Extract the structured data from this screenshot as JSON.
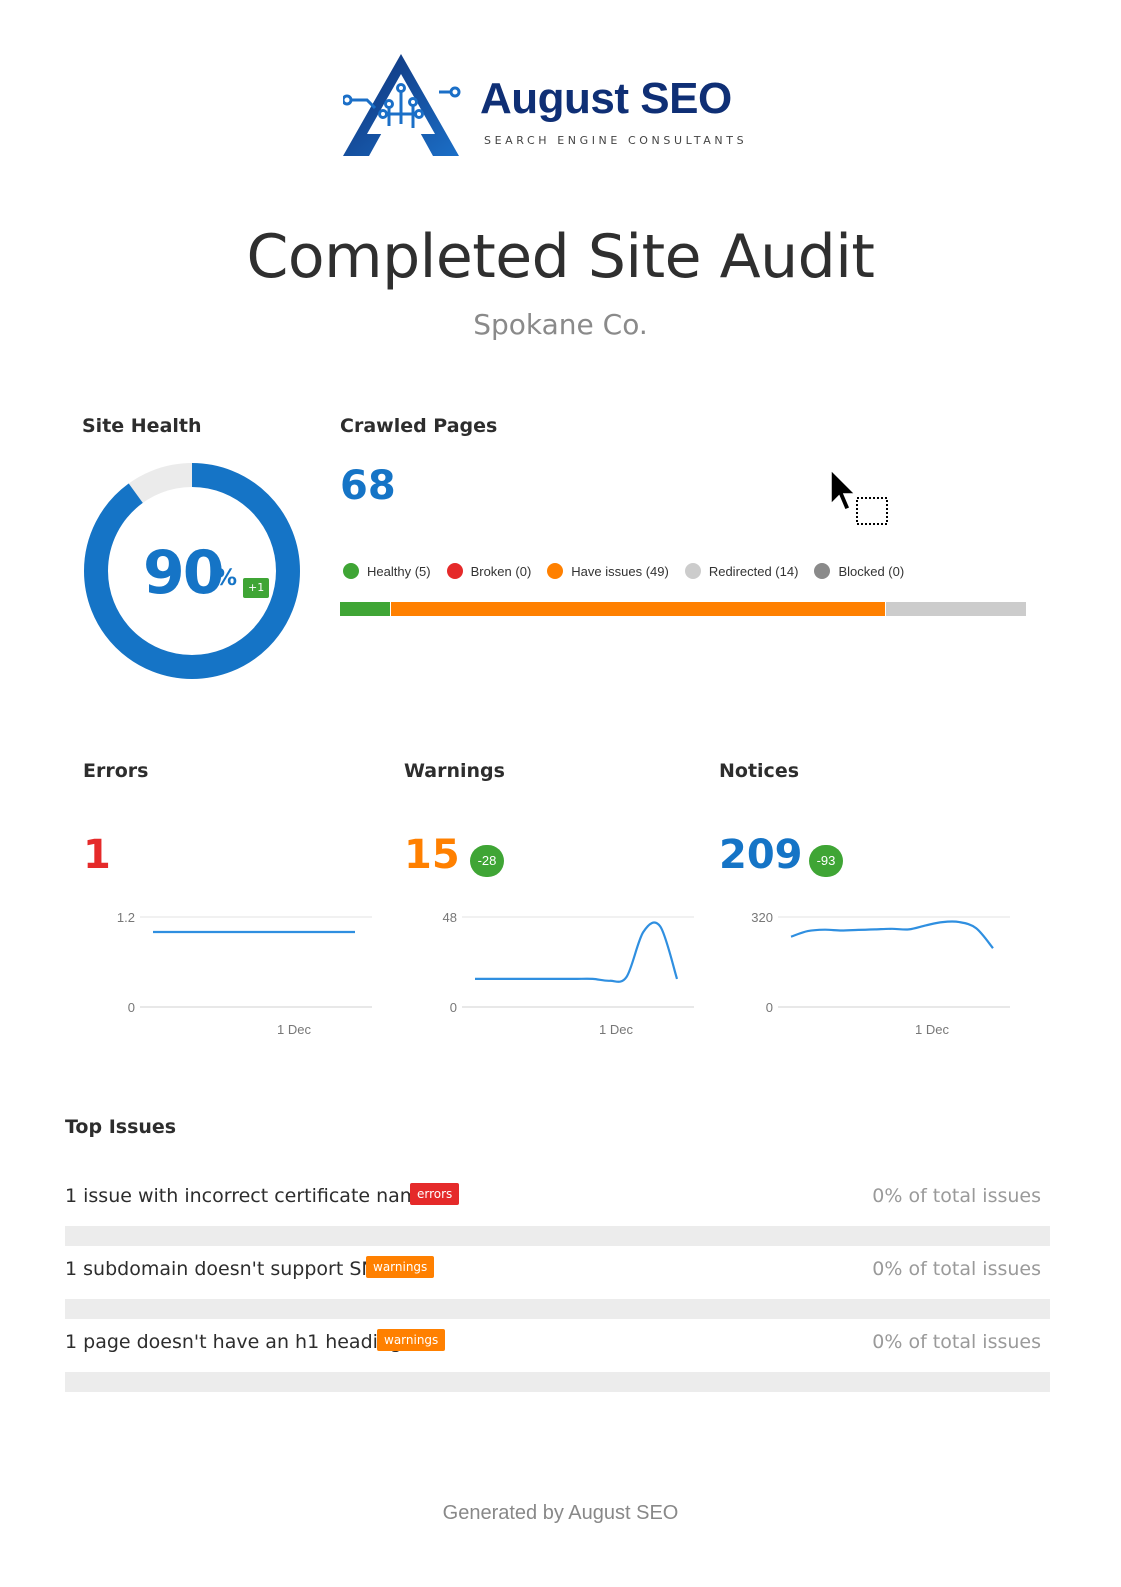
{
  "brand": {
    "name": "August SEO",
    "tagline": "SEARCH ENGINE CONSULTANTS",
    "logo_icon": "circuit-triangle-a-logo",
    "colors": {
      "navy": "#0f2f75",
      "blue": "#1b6fc7"
    }
  },
  "report": {
    "title": "Completed Site Audit",
    "subtitle": "Spokane Co."
  },
  "site_health": {
    "label": "Site Health",
    "value": "90",
    "unit": "%",
    "delta": "+1",
    "percent": 90,
    "color": "#1574c6"
  },
  "crawled_pages": {
    "label": "Crawled Pages",
    "value": "68",
    "legend": [
      {
        "label": "Healthy (5)",
        "count": 5,
        "color": "#3fa535"
      },
      {
        "label": "Broken (0)",
        "count": 0,
        "color": "#e52a2a"
      },
      {
        "label": "Have issues (49)",
        "count": 49,
        "color": "#ff8000"
      },
      {
        "label": "Redirected (14)",
        "count": 14,
        "color": "#cccccc"
      },
      {
        "label": "Blocked (0)",
        "count": 0,
        "color": "#8a8a8a"
      }
    ]
  },
  "metrics": {
    "errors": {
      "label": "Errors",
      "value": "1",
      "color": "#e52a2a"
    },
    "warnings": {
      "label": "Warnings",
      "value": "15",
      "delta": "-28",
      "color": "#ff8000"
    },
    "notices": {
      "label": "Notices",
      "value": "209",
      "delta": "-93",
      "color": "#1574c6"
    }
  },
  "chart_data": [
    {
      "type": "line",
      "name": "errors-trend",
      "ylim": [
        0,
        1.2
      ],
      "yticks": [
        "1.2",
        "0"
      ],
      "xticks": [
        "1 Dec"
      ],
      "values": [
        1,
        1,
        1,
        1,
        1,
        1,
        1,
        1,
        1,
        1,
        1,
        1,
        1
      ],
      "color": "#2f8fe0"
    },
    {
      "type": "line",
      "name": "warnings-trend",
      "ylim": [
        0,
        48
      ],
      "yticks": [
        "48",
        "0"
      ],
      "xticks": [
        "1 Dec"
      ],
      "values": [
        15,
        15,
        15,
        15,
        15,
        15,
        15,
        15,
        14,
        16,
        40,
        43,
        15
      ],
      "color": "#2f8fe0"
    },
    {
      "type": "line",
      "name": "notices-trend",
      "ylim": [
        0,
        320
      ],
      "yticks": [
        "320",
        "0"
      ],
      "xticks": [
        "1 Dec"
      ],
      "values": [
        250,
        270,
        275,
        272,
        274,
        276,
        278,
        276,
        290,
        302,
        302,
        280,
        209
      ],
      "color": "#2f8fe0"
    }
  ],
  "top_issues": {
    "title": "Top Issues",
    "items": [
      {
        "text": "1 issue with incorrect certificate name",
        "badge": "errors",
        "badge_color": "#e52a2a",
        "share": "0% of total issues"
      },
      {
        "text": "1 subdomain doesn't support SNI",
        "badge": "warnings",
        "badge_color": "#ff8000",
        "share": "0% of total issues"
      },
      {
        "text": "1 page doesn't have an h1 heading",
        "badge": "warnings",
        "badge_color": "#ff8000",
        "share": "0% of total issues"
      }
    ]
  },
  "footer": {
    "text": "Generated by August SEO"
  }
}
